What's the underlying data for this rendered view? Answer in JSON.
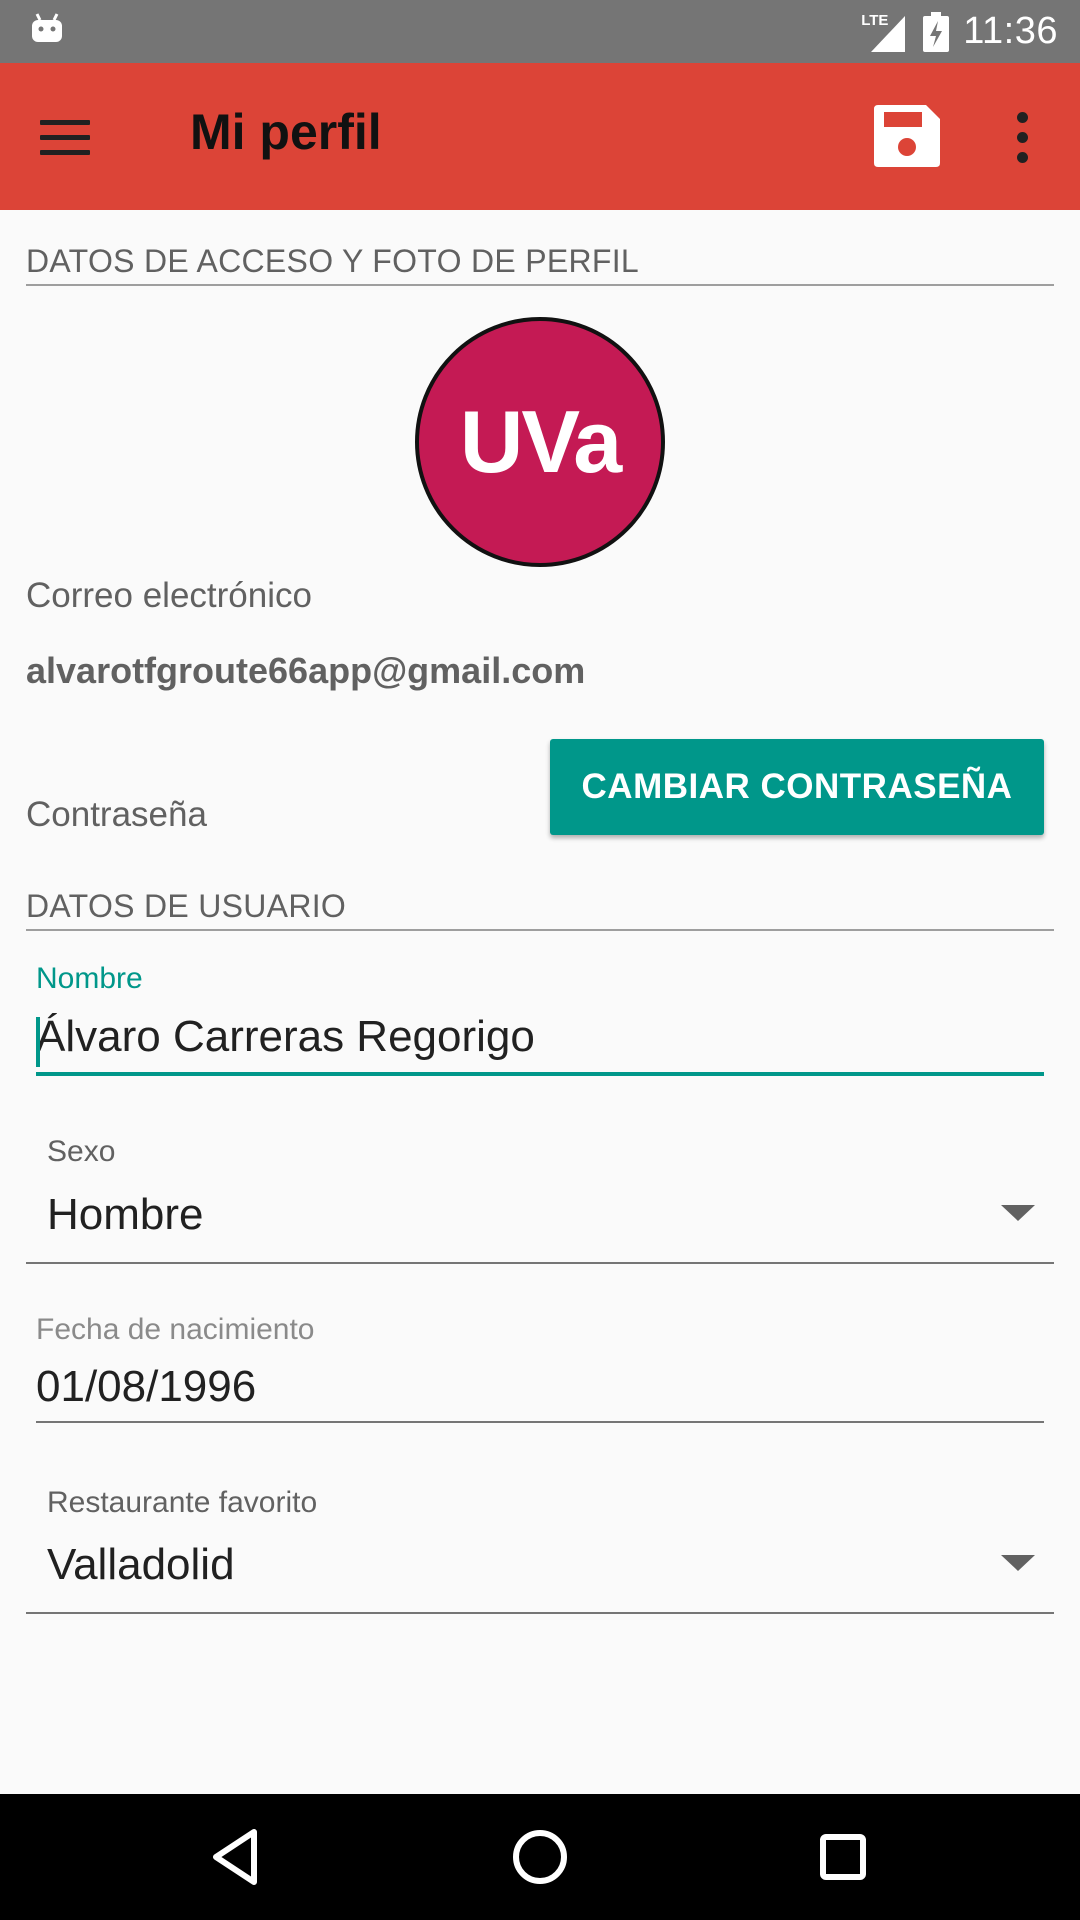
{
  "status_bar": {
    "time": "11:36",
    "network": "LTE",
    "icons": [
      "android-icon",
      "lte-signal-icon",
      "battery-charging-icon"
    ]
  },
  "app_bar": {
    "title": "Mi perfil",
    "background_color": "#dc4437",
    "icons": [
      "menu-icon",
      "save-icon",
      "more-vert-icon"
    ]
  },
  "access_section": {
    "header": "DATOS DE ACCESO Y FOTO DE PERFIL",
    "avatar_text": "UVa",
    "avatar_color": "#c41a54",
    "email_label": "Correo electrónico",
    "email_value": "alvarotfgroute66app@gmail.com",
    "password_label": "Contraseña",
    "change_password_button": "CAMBIAR CONTRASEÑA",
    "button_color": "#00978a"
  },
  "user_section": {
    "header": "DATOS DE USUARIO",
    "name": {
      "label": "Nombre",
      "value": "Álvaro Carreras Regorigo"
    },
    "sex": {
      "label": "Sexo",
      "value": "Hombre"
    },
    "birth_date": {
      "label": "Fecha de nacimiento",
      "value": "01/08/1996"
    },
    "favorite_restaurant": {
      "label": "Restaurante favorito",
      "value": "Valladolid"
    }
  },
  "nav_bar": {
    "icons": [
      "back-icon",
      "home-icon",
      "recents-icon"
    ]
  }
}
